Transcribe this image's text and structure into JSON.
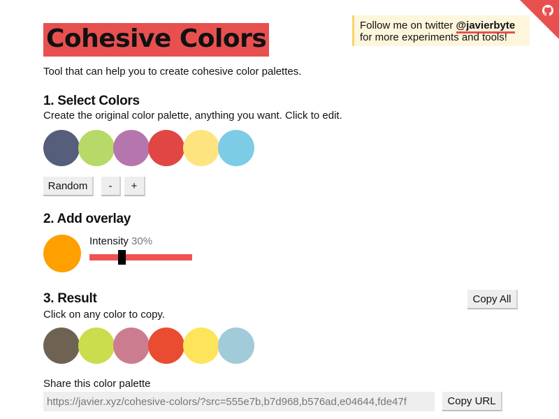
{
  "header": {
    "title": "Cohesive Colors",
    "subtitle": "Tool that can help you to create cohesive color palettes."
  },
  "twitter": {
    "line1_prefix": "Follow me on twitter ",
    "handle": "@javierbyte",
    "line2": "for more experiments and tools!"
  },
  "corner": {
    "icon": "github-icon",
    "color": "#e85050"
  },
  "section1": {
    "heading": "1. Select Colors",
    "description": "Create the original color palette, anything you want. Click to edit.",
    "colors": [
      "#555e7b",
      "#b7d968",
      "#b576ad",
      "#e04644",
      "#fde47f",
      "#7ccce5"
    ],
    "random_label": "Random",
    "minus_label": "-",
    "plus_label": "+"
  },
  "section2": {
    "heading": "2. Add overlay",
    "overlay_color": "#ff9f00",
    "intensity_label": "Intensity",
    "intensity_value": "30%",
    "intensity_fraction": 0.3
  },
  "section3": {
    "heading": "3. Result",
    "description": "Click on any color to copy.",
    "copy_all_label": "Copy All",
    "colors": [
      "#6e6352",
      "#cbdd4d",
      "#cb7d8f",
      "#e94c30",
      "#fde45a",
      "#a1cbd8"
    ]
  },
  "share": {
    "label": "Share this color palette",
    "url": "https://javier.xyz/cohesive-colors/?src=555e7b,b7d968,b576ad,e04644,fde47f",
    "copy_url_label": "Copy URL"
  }
}
